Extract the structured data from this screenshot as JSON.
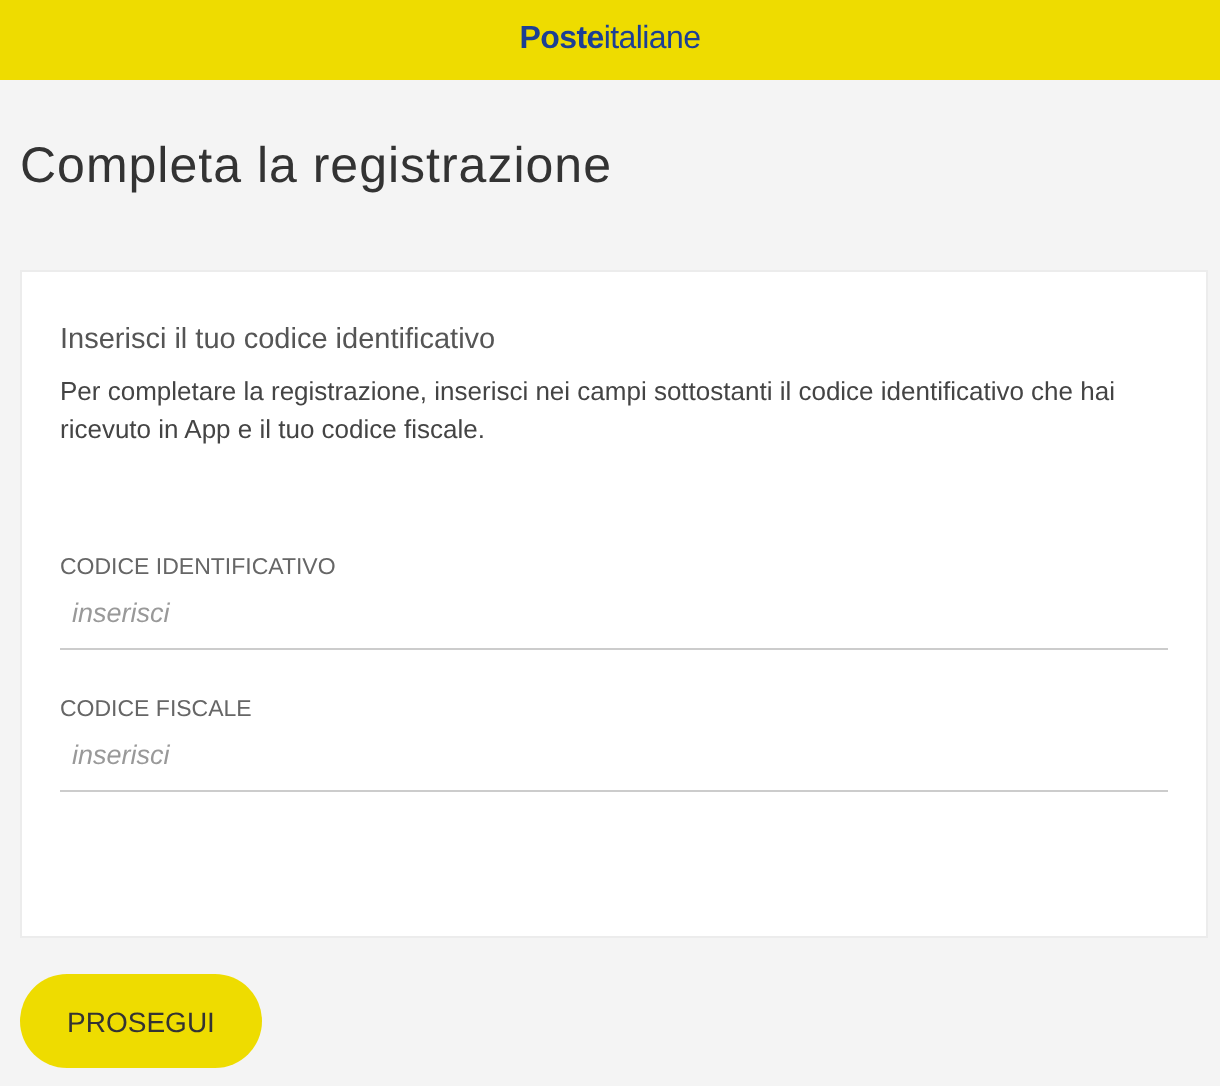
{
  "header": {
    "logo": "**Poste**italiane"
  },
  "page_title": "Completa la registrazione",
  "card": {
    "heading": "Inserisci il tuo codice identificativo",
    "description": "Per completare la registrazione, inserisci nei campi sottostanti il codice identificativo che hai ricevuto in App e il tuo codice fiscale.",
    "fields": [
      {
        "label": "CODICE IDENTIFICATIVO",
        "placeholder": "inserisci"
      },
      {
        "label": "CODICE FISCALE",
        "placeholder": "inserisci"
      }
    ]
  },
  "buttons": [
    "PROSEGUI"
  ]
}
